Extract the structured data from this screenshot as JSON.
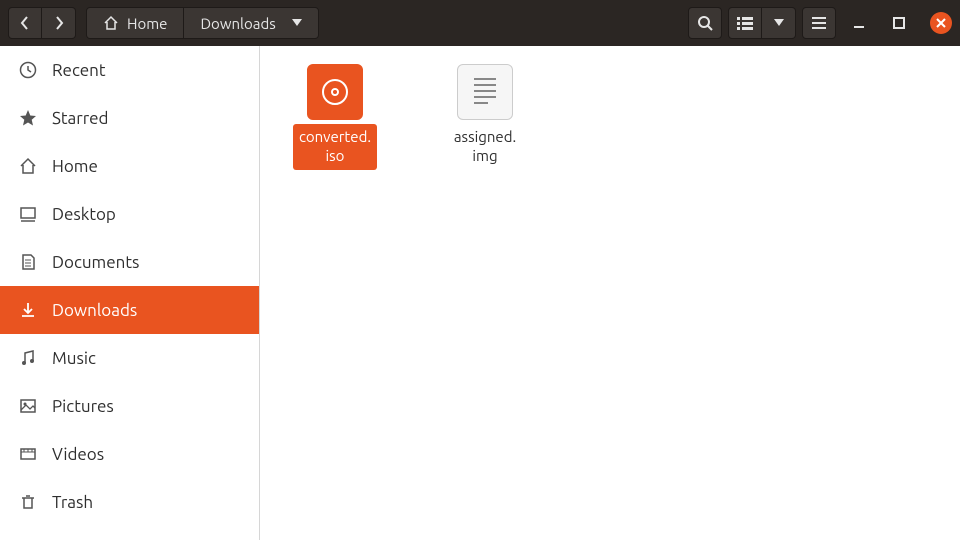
{
  "colors": {
    "accent": "#e95420"
  },
  "header": {
    "path": [
      {
        "label": "Home",
        "icon": "home"
      },
      {
        "label": "Downloads",
        "dropdown": true
      }
    ]
  },
  "sidebar": {
    "items": [
      {
        "icon": "recent",
        "label": "Recent"
      },
      {
        "icon": "star",
        "label": "Starred"
      },
      {
        "icon": "home",
        "label": "Home"
      },
      {
        "icon": "desktop",
        "label": "Desktop"
      },
      {
        "icon": "documents",
        "label": "Documents"
      },
      {
        "icon": "downloads",
        "label": "Downloads",
        "active": true
      },
      {
        "icon": "music",
        "label": "Music"
      },
      {
        "icon": "pictures",
        "label": "Pictures"
      },
      {
        "icon": "videos",
        "label": "Videos"
      },
      {
        "icon": "trash",
        "label": "Trash"
      }
    ]
  },
  "files": [
    {
      "name": "converted.\niso",
      "type": "disc-image",
      "selected": true
    },
    {
      "name": "assigned.\nimg",
      "type": "text-file",
      "selected": false
    }
  ]
}
